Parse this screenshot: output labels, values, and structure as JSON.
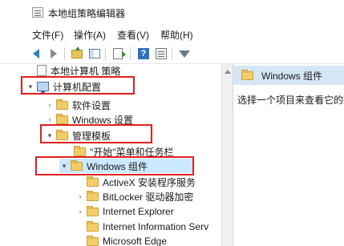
{
  "window": {
    "title": "本地组策略编辑器"
  },
  "menu": [
    "文件(F)",
    "操作(A)",
    "查看(V)",
    "帮助(H)"
  ],
  "toolbar": {
    "buttons": [
      "back-icon",
      "forward-icon",
      "up-folder-icon",
      "show-hide-tree-icon",
      "export-list-icon",
      "help-icon",
      "properties-icon",
      "filter-icon"
    ],
    "help_glyph": "?"
  },
  "tree": {
    "items": [
      {
        "label": "本地计算机 策略",
        "level": 0,
        "expander": "",
        "icon": "document-icon"
      },
      {
        "label": "计算机配置",
        "level": 0,
        "expander": "▾",
        "icon": "computer-icon"
      },
      {
        "label": "软件设置",
        "level": 1,
        "expander": "›",
        "icon": "folder-icon"
      },
      {
        "label": "Windows 设置",
        "level": 1,
        "expander": "›",
        "icon": "folder-icon"
      },
      {
        "label": "管理模板",
        "level": 1,
        "expander": "▾",
        "icon": "folder-icon"
      },
      {
        "label": "\"开始\"菜单和任务栏",
        "level": 2,
        "expander": "",
        "icon": "folder-icon"
      },
      {
        "label": "Windows 组件",
        "level": 2,
        "expander": "▾",
        "icon": "folder-icon",
        "selected": true
      },
      {
        "label": "ActiveX 安装程序服务",
        "level": 3,
        "expander": "",
        "icon": "folder-icon"
      },
      {
        "label": "BitLocker 驱动器加密",
        "level": 3,
        "expander": "›",
        "icon": "folder-icon"
      },
      {
        "label": "Internet Explorer",
        "level": 3,
        "expander": "›",
        "icon": "folder-icon"
      },
      {
        "label": "Internet Information Serv",
        "level": 3,
        "expander": "",
        "icon": "folder-icon"
      },
      {
        "label": "Microsoft Edge",
        "level": 3,
        "expander": "",
        "icon": "folder-icon"
      }
    ]
  },
  "details": {
    "header": "Windows 组件",
    "description": "选择一个项目来查看它的描"
  },
  "colors": {
    "selection": "#cce8ff",
    "highlight_box": "#e02020",
    "header_bg": "#d5e6f7",
    "folder": "#f2cd6a"
  }
}
